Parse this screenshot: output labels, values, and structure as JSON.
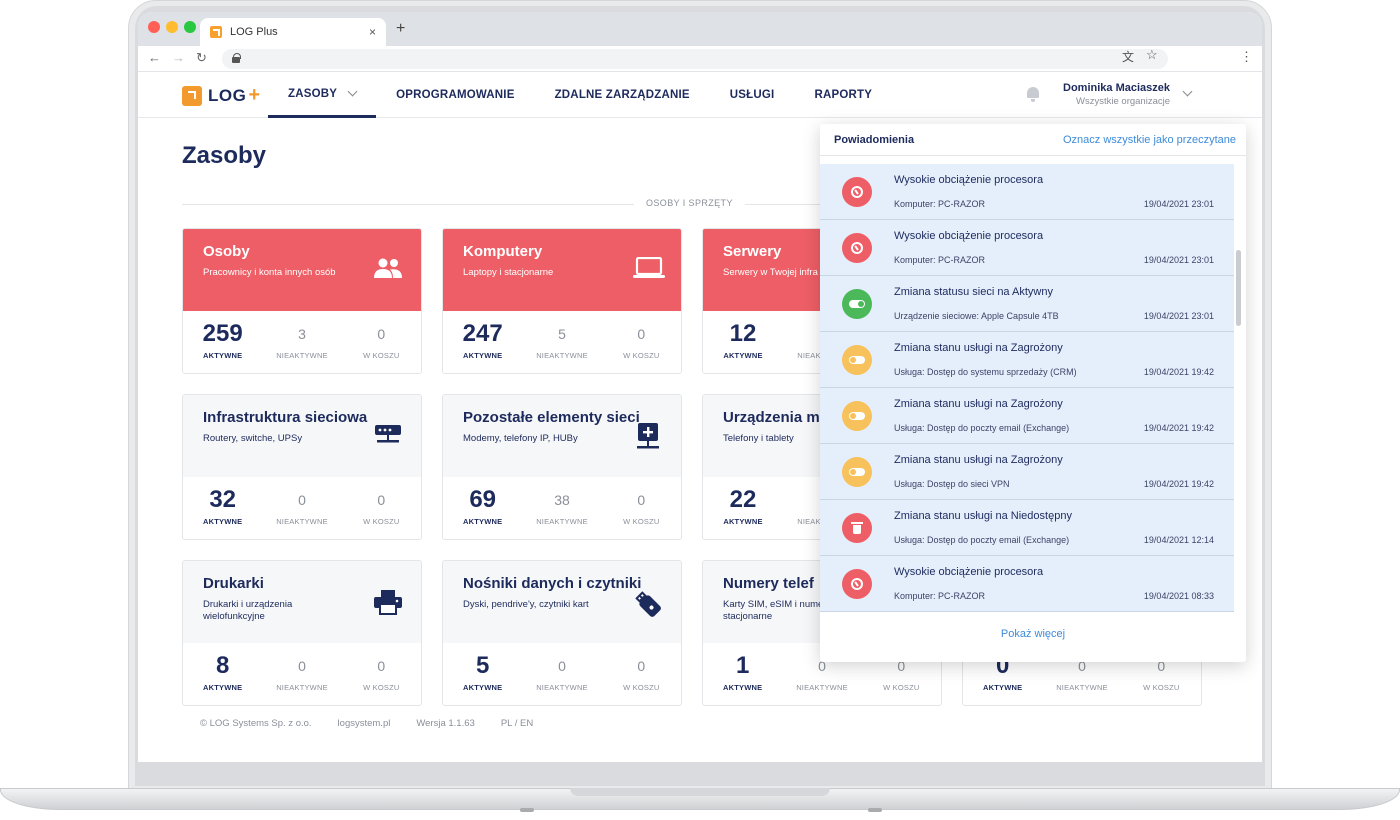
{
  "browser": {
    "tab_title": "LOG Plus",
    "tab_close": "×",
    "new_tab": "+",
    "back": "←",
    "forward": "→",
    "reload": "↻"
  },
  "header": {
    "logo_text": "LOG",
    "logo_plus": "+",
    "nav": [
      {
        "label": "ZASOBY"
      },
      {
        "label": "OPROGRAMOWANIE"
      },
      {
        "label": "ZDALNE ZARZĄDZANIE"
      },
      {
        "label": "USŁUGI"
      },
      {
        "label": "RAPORTY"
      }
    ],
    "user_name": "Dominika Maciaszek",
    "user_org": "Wszystkie organizacje"
  },
  "main": {
    "title": "Zasoby",
    "section": "OSOBY I SPRZĘTY",
    "stat_labels": {
      "active": "AKTYWNE",
      "inactive": "NIEAKTYWNE",
      "trash": "W KOSZU"
    },
    "cards": [
      {
        "title": "Osoby",
        "subtitle": "Pracownicy i konta innych osób",
        "active": "259",
        "inactive": "3",
        "trash": "0"
      },
      {
        "title": "Komputery",
        "subtitle": "Laptopy i stacjonarne",
        "active": "247",
        "inactive": "5",
        "trash": "0"
      },
      {
        "title": "Serwery",
        "subtitle": "Serwery w Twojej infra",
        "active": "12",
        "inactive": "",
        "trash": ""
      },
      {
        "title": "Infrastruktura sieciowa",
        "subtitle": "Routery, switche, UPSy",
        "active": "32",
        "inactive": "0",
        "trash": "0"
      },
      {
        "title": "Pozostałe elementy sieci",
        "subtitle": "Modemy, telefony IP, HUBy",
        "active": "69",
        "inactive": "38",
        "trash": "0"
      },
      {
        "title": "Urządzenia m",
        "subtitle": "Telefony i tablety",
        "active": "22",
        "inactive": "",
        "trash": ""
      },
      {
        "title": "Drukarki",
        "subtitle": "Drukarki i urządzenia wielofunkcyjne",
        "active": "8",
        "inactive": "0",
        "trash": "0"
      },
      {
        "title": "Nośniki danych i czytniki",
        "subtitle": "Dyski, pendrive'y, czytniki kart",
        "active": "5",
        "inactive": "0",
        "trash": "0"
      },
      {
        "title": "Numery telef",
        "subtitle": "Karty SIM, eSIM i nume stacjonarne",
        "active": "1",
        "inactive": "0",
        "trash": "0"
      },
      {
        "title": "",
        "subtitle": "",
        "active": "0",
        "inactive": "0",
        "trash": "0"
      }
    ]
  },
  "footer": {
    "company": "© LOG Systems Sp. z o.o.",
    "site": "logsystem.pl",
    "version": "Wersja 1.1.63",
    "lang": "PL / EN"
  },
  "notifications": {
    "title": "Powiadomienia",
    "mark_all": "Oznacz wszystkie jako przeczytane",
    "show_more": "Pokaż więcej",
    "items": [
      {
        "text": "Wysokie obciążenie procesora",
        "meta": "Komputer: PC-RAZOR",
        "time": "19/04/2021 23:01",
        "type": "cpu"
      },
      {
        "text": "Wysokie obciążenie procesora",
        "meta": "Komputer: PC-RAZOR",
        "time": "19/04/2021 23:01",
        "type": "cpu"
      },
      {
        "text": "Zmiana statusu sieci na Aktywny",
        "meta": "Urządzenie sieciowe: Apple Capsule 4TB",
        "time": "19/04/2021 23:01",
        "type": "active"
      },
      {
        "text": "Zmiana stanu usługi na Zagrożony",
        "meta": "Usługa: Dostęp do systemu sprzedaży (CRM)",
        "time": "19/04/2021 19:42",
        "type": "warning"
      },
      {
        "text": "Zmiana stanu usługi na Zagrożony",
        "meta": "Usługa: Dostęp do poczty email (Exchange)",
        "time": "19/04/2021 19:42",
        "type": "warning"
      },
      {
        "text": "Zmiana stanu usługi na Zagrożony",
        "meta": "Usługa: Dostęp do sieci VPN",
        "time": "19/04/2021 19:42",
        "type": "warning"
      },
      {
        "text": "Zmiana stanu usługi na Niedostępny",
        "meta": "Usługa: Dostęp do poczty email (Exchange)",
        "time": "19/04/2021 12:14",
        "type": "unavailable"
      },
      {
        "text": "Wysokie obciążenie procesora",
        "meta": "Komputer: PC-RAZOR",
        "time": "19/04/2021 08:33",
        "type": "cpu"
      }
    ]
  },
  "colors": {
    "accent": "#1d2a5c",
    "card_red": "#ee5e66",
    "link": "#3d8bd9",
    "logo": "#f29a2e",
    "notif_bg": "#e5effb"
  }
}
